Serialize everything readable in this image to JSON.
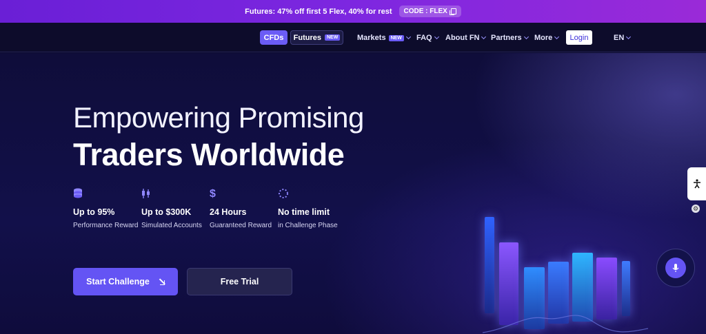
{
  "promo": {
    "text": "Futures: 47% off first 5 Flex, 40% for rest",
    "code_label": "CODE : FLEX"
  },
  "nav": {
    "cfds": "CFDs",
    "futures": "Futures",
    "futures_badge": "NEW",
    "markets": "Markets",
    "markets_badge": "NEW",
    "faq": "FAQ",
    "about": "About FN",
    "partners": "Partners",
    "more": "More",
    "login": "Login",
    "language": "EN"
  },
  "hero": {
    "headline_light": "Empowering Promising",
    "headline_bold": "Traders Worldwide",
    "features": [
      {
        "icon": "coins-icon",
        "value": "Up to 95%",
        "sub": "Performance Reward"
      },
      {
        "icon": "candlestick-icon",
        "value": "Up to $300K",
        "sub": "Simulated Accounts"
      },
      {
        "icon": "dollar-icon",
        "value": "24 Hours",
        "sub": "Guaranteed Reward"
      },
      {
        "icon": "spinner-icon",
        "value": "No time limit",
        "sub": "in Challenge Phase"
      }
    ],
    "start_button": "Start Challenge",
    "trial_button": "Free Trial"
  },
  "colors": {
    "accent": "#6454f4",
    "promo_start": "#6a1fd6",
    "promo_end": "#9a2ad8",
    "background": "#0f0d3a"
  }
}
